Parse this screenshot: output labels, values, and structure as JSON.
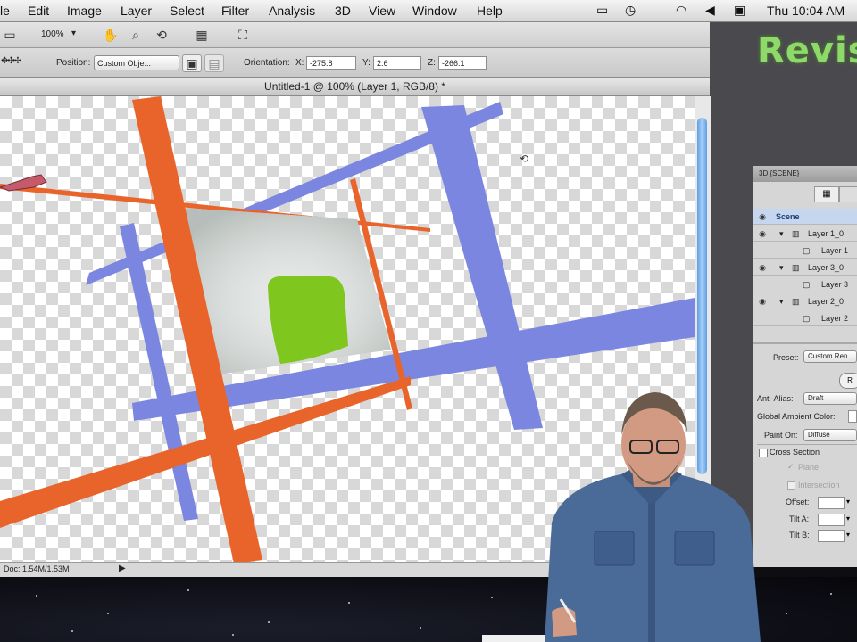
{
  "menubar": {
    "items": [
      "le",
      "Edit",
      "Image",
      "Layer",
      "Select",
      "Filter",
      "Analysis",
      "3D",
      "View",
      "Window",
      "Help"
    ],
    "clock": "Thu 10:04 AM"
  },
  "options": {
    "zoom": "100%",
    "position_label": "Position:",
    "position_value": "Custom Obje...",
    "orientation_label": "Orientation:",
    "x_label": "X:",
    "x_value": "-275.8",
    "y_label": "Y:",
    "y_value": "2.6",
    "z_label": "Z:",
    "z_value": "-266.1"
  },
  "brand": {
    "text": "Revis"
  },
  "document": {
    "title": "Untitled-1 @ 100% (Layer 1, RGB/8) *",
    "status": "Doc: 1.54M/1.53M"
  },
  "panel": {
    "title": "3D {SCENE}",
    "scene_label": "Scene",
    "layers": [
      {
        "label": "Layer 1_0",
        "type": "group"
      },
      {
        "label": "Layer 1",
        "type": "child"
      },
      {
        "label": "Layer 3_0",
        "type": "group"
      },
      {
        "label": "Layer 3",
        "type": "child"
      },
      {
        "label": "Layer 2_0",
        "type": "group"
      },
      {
        "label": "Layer 2",
        "type": "child"
      }
    ],
    "preset_label": "Preset:",
    "preset_value": "Custom Ren",
    "render_btn": "R",
    "antialias_label": "Anti-Alias:",
    "antialias_value": "Draft",
    "ambient_label": "Global Ambient Color:",
    "painton_label": "Paint On:",
    "painton_value": "Diffuse",
    "cross_section_label": "Cross Section",
    "plane_label": "Plane",
    "intersection_label": "Intersection",
    "offset_label": "Offset:",
    "tilta_label": "Tilt A:",
    "tiltb_label": "Tilt B:"
  },
  "colors": {
    "orange": "#e8642a",
    "blue": "#7b86e0",
    "brand_green": "#8fd86a",
    "scroll_blue": "#5e9ee6"
  }
}
